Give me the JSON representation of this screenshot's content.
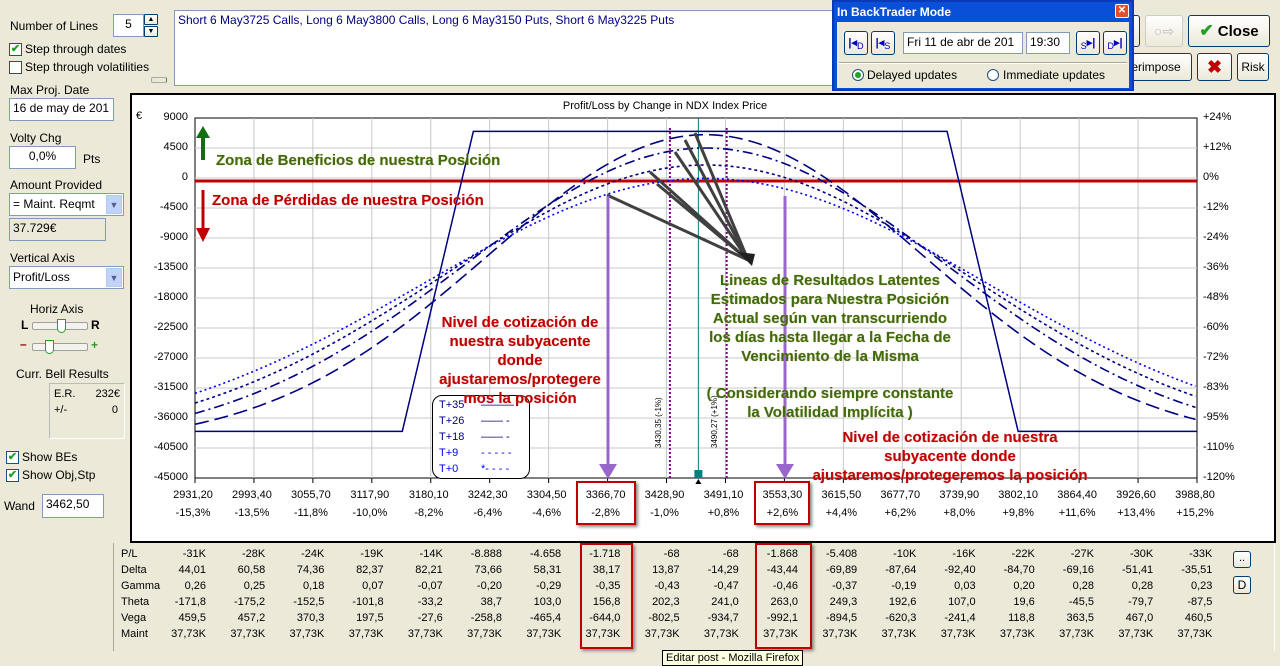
{
  "left_panel": {
    "num_lines_label": "Number of Lines",
    "num_lines_value": "5",
    "step_dates_label": "Step through dates",
    "step_dates_checked": true,
    "step_vols_label": "Step through volatilities",
    "step_vols_checked": false,
    "max_proj_date_label": "Max Proj. Date",
    "max_proj_date_value": "16 de may de 201",
    "volty_chg_label": "Volty Chg",
    "volty_chg_value": "0,0%",
    "volty_units": "Pts",
    "amount_provided_label": "Amount Provided",
    "amount_provided_value": "= Maint. Reqmt",
    "amount_value": "37.729€",
    "vertical_axis_label": "Vertical Axis",
    "vertical_axis_value": "Profit/Loss",
    "horiz_axis_label": "Horiz Axis",
    "slider_l": "L",
    "slider_r": "R",
    "slider_minus": "–",
    "slider_plus": "+",
    "bell_results_label": "Curr. Bell Results",
    "er_label": "E.R.",
    "er_value": "232€",
    "pm_label": "+/-",
    "pm_value": "0",
    "show_bes_label": "Show BEs",
    "show_objstp_label": "Show Obj,Stp",
    "wand_label": "Wand",
    "wand_value": "3462,50"
  },
  "position_text": "Short 6 May3725 Calls, Long 6 May3800 Calls, Long 6 May3150 Puts, Short 6 May3225 Puts",
  "backtrader": {
    "title": "In BackTrader Mode",
    "btn_back_day": "D",
    "btn_back_step": "S",
    "date_value": "Fri 11 de abr de 201",
    "time_value": "19:30",
    "btn_fwd_step": "S",
    "btn_fwd_day": "D",
    "delayed_label": "Delayed updates",
    "immediate_label": "Immediate updates",
    "selected": "delayed"
  },
  "toolbar": {
    "close_label": "Close",
    "superimpose_label": "erimpose",
    "risk_label": "Risk"
  },
  "chart_data": {
    "type": "line",
    "title": "Profit/Loss by Change in NDX Index Price",
    "currency": "€",
    "ylim": [
      -45000,
      9000
    ],
    "yticks": [
      "9000",
      "4500",
      "0",
      "-4500",
      "-9000",
      "-13500",
      "-18000",
      "-22500",
      "-27000",
      "-31500",
      "-36000",
      "-40500",
      "-45000"
    ],
    "yticks_right": [
      "+24%",
      "+12%",
      "0%",
      "-12%",
      "-24%",
      "-36%",
      "-48%",
      "-60%",
      "-72%",
      "-83%",
      "-95%",
      "-110%",
      "-120%"
    ],
    "xlim": [
      2931.2,
      3988.8
    ],
    "xticks": [
      "2931,20",
      "2993,40",
      "3055,70",
      "3117,90",
      "3180,10",
      "3242,30",
      "3304,50",
      "3366,70",
      "3428,90",
      "3491,10",
      "3553,30",
      "3615,50",
      "3677,70",
      "3739,90",
      "3802,10",
      "3864,40",
      "3926,60",
      "3988,80"
    ],
    "xticks_pct": [
      "-15,3%",
      "-13,5%",
      "-11,8%",
      "-10,0%",
      "-8,2%",
      "-6,4%",
      "-4,6%",
      "-2,8%",
      "-1,0%",
      "+0,8%",
      "+2,6%",
      "+4,4%",
      "+6,2%",
      "+8,0%",
      "+9,8%",
      "+11,6%",
      "+13,4%",
      "+15,2%"
    ],
    "expiry_series": {
      "name": "T+35",
      "points": [
        [
          2931.2,
          -38000
        ],
        [
          3150,
          -38000
        ],
        [
          3225,
          7000
        ],
        [
          3725,
          7000
        ],
        [
          3800,
          -38000
        ],
        [
          3988.8,
          -38000
        ]
      ]
    },
    "series": [
      {
        "name": "T+26",
        "center": 3470,
        "peak": 6500,
        "floor": -40000,
        "sigma": 231
      },
      {
        "name": "T+18",
        "center": 3470,
        "peak": 4500,
        "floor": -40000,
        "sigma": 254
      },
      {
        "name": "T+9",
        "center": 3470,
        "peak": 1950,
        "floor": -40000,
        "sigma": 276
      },
      {
        "name": "T+0",
        "center": 3470,
        "peak": -68,
        "floor": -40000,
        "sigma": 297
      }
    ],
    "legend": [
      {
        "name": "T+35",
        "sample": "———"
      },
      {
        "name": "T+26",
        "sample": "—— -"
      },
      {
        "name": "T+18",
        "sample": "—— -"
      },
      {
        "name": "T+9",
        "sample": "- - - - -"
      },
      {
        "name": "T+0",
        "sample": "*- - - -"
      }
    ],
    "markers": {
      "lower": "3430,35 (-1%)",
      "upper": "3490,27 (+1%)",
      "lower_value": 3430.35,
      "upper_value": 3490.27,
      "current": 3462.5
    },
    "annotations": {
      "profit_zone": "Zona de Beneficios de nuestra Posición",
      "loss_zone": "Zona de Pérdidas de nuestra Posición",
      "latent_lines": [
        "Lineas de Resultados Latentes",
        "Estimados para Nuestra Posición",
        "Actual según van transcurriendo",
        "los días hasta llegar a la Fecha de",
        "Vencimiento de la Misma"
      ],
      "constant_vol": [
        "( Considerando siempre constante",
        "la Volatilidad Implícita )"
      ],
      "adjust_left": [
        "Nivel de cotización de",
        "nuestra subyacente",
        "donde",
        "ajustaremos/protegere",
        "mos la posición"
      ],
      "adjust_right": [
        "Nivel de cotización de nuestra",
        "subyacente donde",
        "ajustaremos/protegeremos la posición"
      ]
    }
  },
  "greeks_table": {
    "rows": [
      {
        "label": "P/L",
        "values": [
          "-31K",
          "-28K",
          "-24K",
          "-19K",
          "-14K",
          "-8.888",
          "-4.658",
          "-1.718",
          "-68",
          "-68",
          "-1.868",
          "-5.408",
          "-10K",
          "-16K",
          "-22K",
          "-27K",
          "-30K",
          "-33K"
        ]
      },
      {
        "label": "Delta",
        "values": [
          "44,01",
          "60,58",
          "74,36",
          "82,37",
          "82,21",
          "73,66",
          "58,31",
          "38,17",
          "13,87",
          "-14,29",
          "-43,44",
          "-69,89",
          "-87,64",
          "-92,40",
          "-84,70",
          "-69,16",
          "-51,41",
          "-35,51"
        ]
      },
      {
        "label": "Gamma",
        "values": [
          "0,26",
          "0,25",
          "0,18",
          "0,07",
          "-0,07",
          "-0,20",
          "-0,29",
          "-0,35",
          "-0,43",
          "-0,47",
          "-0,46",
          "-0,37",
          "-0,19",
          "0,03",
          "0,20",
          "0,28",
          "0,28",
          "0,23"
        ]
      },
      {
        "label": "Theta",
        "values": [
          "-171,8",
          "-175,2",
          "-152,5",
          "-101,8",
          "-33,2",
          "38,7",
          "103,0",
          "156,8",
          "202,3",
          "241,0",
          "263,0",
          "249,3",
          "192,6",
          "107,0",
          "19,6",
          "-45,5",
          "-79,7",
          "-87,5"
        ]
      },
      {
        "label": "Vega",
        "values": [
          "459,5",
          "457,2",
          "370,3",
          "197,5",
          "-27,6",
          "-258,8",
          "-465,4",
          "-644,0",
          "-802,5",
          "-934,7",
          "-992,1",
          "-894,5",
          "-620,3",
          "-241,4",
          "118,8",
          "363,5",
          "467,0",
          "460,5"
        ]
      },
      {
        "label": "Maint",
        "values": [
          "37,73K",
          "37,73K",
          "37,73K",
          "37,73K",
          "37,73K",
          "37,73K",
          "37,73K",
          "37,73K",
          "37,73K",
          "37,73K",
          "37,73K",
          "37,73K",
          "37,73K",
          "37,73K",
          "37,73K",
          "37,73K",
          "37,73K",
          "37,73K"
        ]
      }
    ],
    "more_button": "..",
    "d_button": "D"
  },
  "tooltip": "Editar post - Mozilla Firefox",
  "colors": {
    "profit": "#3d6b0e",
    "loss": "#c00000",
    "curve": "#000080",
    "purple": "#9966cc",
    "teal": "#008080"
  }
}
